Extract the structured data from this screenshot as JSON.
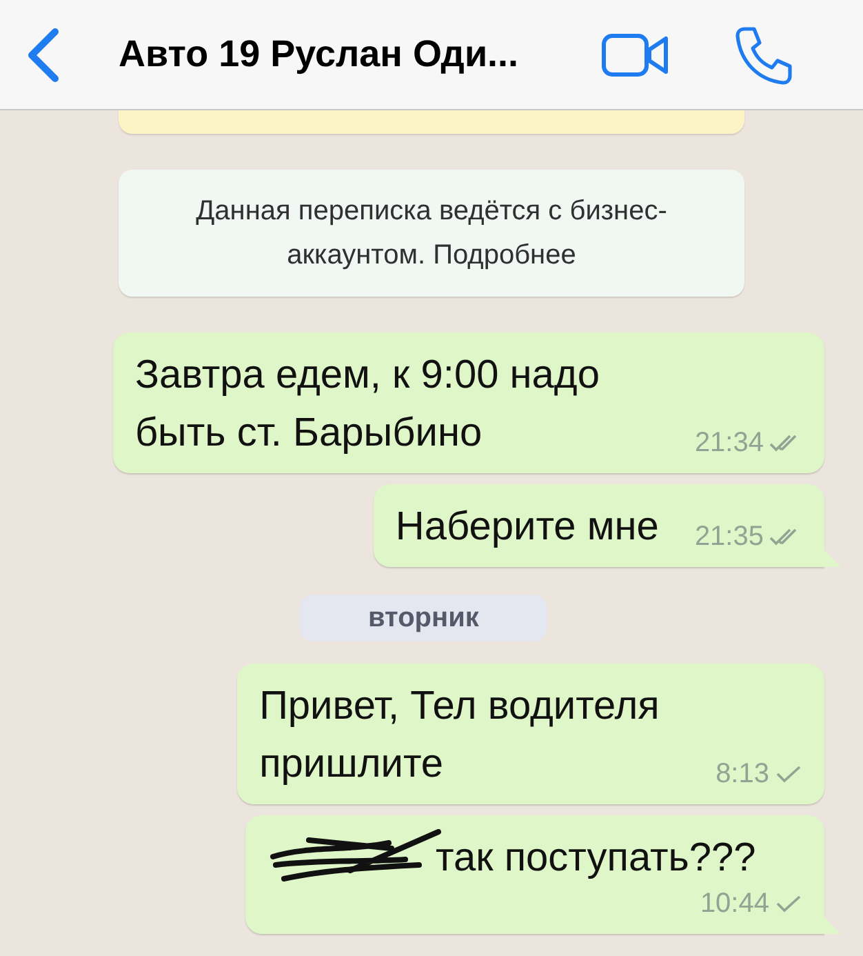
{
  "header": {
    "title": "Авто 19 Руслан Оди..."
  },
  "items": [
    {
      "kind": "notice_cut"
    },
    {
      "kind": "notice",
      "text": "Данная переписка ведётся с бизнес-аккаунтом. Подробнее"
    },
    {
      "kind": "message",
      "text": "Завтра едем, к 9:00 надо быть ст. Барыбино",
      "time": "21:34",
      "delivered": true,
      "tail": false,
      "redacted": false
    },
    {
      "kind": "message",
      "text": "Наберите мне",
      "time": "21:35",
      "delivered": true,
      "tail": true,
      "redacted": false
    },
    {
      "kind": "date",
      "text": "вторник"
    },
    {
      "kind": "message",
      "text": "Привет, Тел водителя пришлите",
      "time": "8:13",
      "delivered": false,
      "tail": false,
      "redacted": false
    },
    {
      "kind": "message",
      "text": "так поступать???",
      "time": "10:44",
      "delivered": false,
      "tail": true,
      "redacted": true
    }
  ]
}
